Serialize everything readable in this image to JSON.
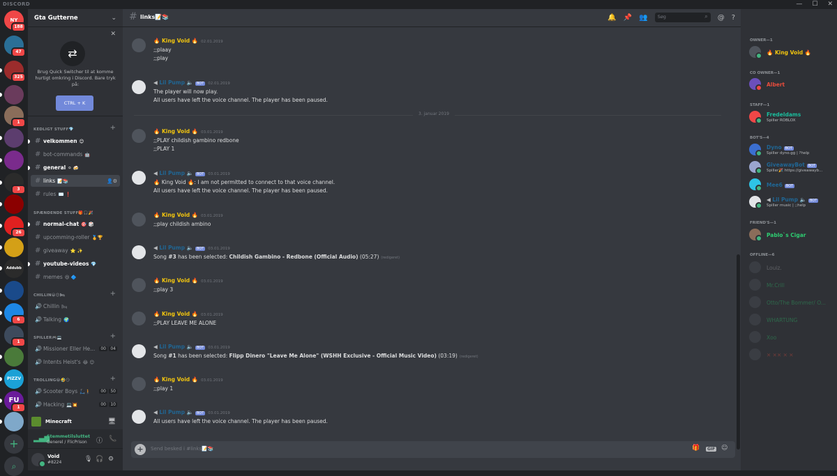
{
  "app": {
    "brand": "DISCORD"
  },
  "window_controls": [
    "—",
    "☐",
    "✕"
  ],
  "guild_rail": {
    "badges": [
      "NY",
      "188",
      "47",
      "325",
      "1",
      "3",
      "26",
      "6",
      "1",
      "1"
    ],
    "text_guilds": [
      "Addubb",
      "PIZZV",
      "FU"
    ]
  },
  "server": {
    "name": "Gta Gutterne"
  },
  "quick_switcher": {
    "message": "Brug Quick Switcher til at komme hurtigt omkring i Discord. Bare tryk på:",
    "button": "CTRL + K"
  },
  "categories": [
    {
      "label": "KEDLIGT STUFF💎"
    },
    {
      "label": "SPÆNDENDE STUFF🎁🎧🎉"
    },
    {
      "label": "CHILLIN😀😊🛏"
    },
    {
      "label": "SPILLER🎮💻"
    },
    {
      "label": "TROLLING😂🤣😏"
    }
  ],
  "channels": {
    "velkommen": {
      "name": "velkommen",
      "extra": "😊"
    },
    "bot_commands": {
      "name": "bot-commands",
      "extra": "🤖"
    },
    "general": {
      "name": "general",
      "extra": "⚪ 🍻"
    },
    "links": {
      "name": "links",
      "extra": "📝📚"
    },
    "rules": {
      "name": "rules",
      "extra": "✉️ ❗"
    },
    "normal_chat": {
      "name": "normal-chat",
      "extra": "🎯 🎲"
    },
    "upcomming_roller": {
      "name": "upcomming-roller",
      "extra": "🏅🏆"
    },
    "giveaway": {
      "name": "giveaway",
      "extra": "⭐ ✨"
    },
    "youtube_videos": {
      "name": "youtube-videos",
      "extra": "💎"
    },
    "memes": {
      "name": "memes",
      "extra": "😆 🔷"
    },
    "chillin": {
      "name": "Chillin",
      "extra": "🛏"
    },
    "talking": {
      "name": "Talking",
      "extra": "🌍"
    },
    "missioner": {
      "name": "Missioner Eller He...",
      "c1": "00",
      "c2": "04"
    },
    "intents": {
      "name": "Intents Heist's",
      "extra": "😂 😊"
    },
    "scooter": {
      "name": "Scooter Boys",
      "extra": "🛴🚶",
      "c1": "00",
      "c2": "50"
    },
    "hacking": {
      "name": "Hacking",
      "extra": "💻💥",
      "c1": "00",
      "c2": "10"
    }
  },
  "minecraft_bar": {
    "name": "Minecraft"
  },
  "voice_status": {
    "title": "Stemmetilsluttet",
    "subtitle": "Generel / FlicPrison"
  },
  "user": {
    "name": "Void",
    "tag": "#8224"
  },
  "chat": {
    "channel": "links📝📚",
    "search_placeholder": "Søg",
    "composer_placeholder": "Send besked i #links📝📚",
    "date_divider": "3. januar 2019",
    "messages": [
      {
        "author": "🔥 King Void 🔥",
        "time": "02.01.2019",
        "lines": [
          ";;plaay",
          ";;play"
        ],
        "color": "#f1c40f"
      },
      {
        "author": "Lil Pump",
        "bot": "BOT",
        "time": "02.01.2019",
        "lines": [
          "The player will now play.",
          "All users have left the voice channel. The player has been paused."
        ],
        "color": "#206694"
      },
      {
        "author": "🔥 King Void 🔥",
        "time": "03.01.2019",
        "lines": [
          ";;PLAY childish gambino redbone",
          ";;PLAY 1"
        ],
        "color": "#f1c40f"
      },
      {
        "author": "Lil Pump",
        "bot": "BOT",
        "time": "03.01.2019",
        "lines": [
          "🔥 King Void 🔥: I am not permitted to connect to that voice channel.",
          "All users have left the voice channel. The player has been paused."
        ],
        "color": "#206694"
      },
      {
        "author": "🔥 King Void 🔥",
        "time": "03.01.2019",
        "lines": [
          ";;play childish ambino"
        ],
        "color": "#f1c40f"
      },
      {
        "author": "Lil Pump",
        "bot": "BOT",
        "time": "03.01.2019",
        "song_prefix": "Song ",
        "song_num": "#3",
        "song_mid": " has been selected: ",
        "song_title": "Childish Gambino - Redbone (Official Audio)",
        "song_dur": " (05:27)",
        "edited": "(redigeret)",
        "color": "#206694"
      },
      {
        "author": "🔥 King Void 🔥",
        "time": "03.01.2019",
        "lines": [
          ";;play 3"
        ],
        "color": "#f1c40f"
      },
      {
        "author": "🔥 King Void 🔥",
        "time": "03.01.2019",
        "lines": [
          ";;PLAY LEAVE ME ALONE"
        ],
        "color": "#f1c40f"
      },
      {
        "author": "Lil Pump",
        "bot": "BOT",
        "time": "03.01.2019",
        "song_prefix": "Song ",
        "song_num": "#1",
        "song_mid": " has been selected: ",
        "song_title": "Flipp Dinero \"Leave Me Alone\" (WSHH Exclusive - Official Music Video)",
        "song_dur": " (03:19)",
        "edited": "(redigeret)",
        "color": "#206694"
      },
      {
        "author": "🔥 King Void 🔥",
        "time": "03.01.2019",
        "lines": [
          ";;play 1"
        ],
        "color": "#f1c40f"
      },
      {
        "author": "Lil Pump",
        "bot": "BOT",
        "time": "03.01.2019",
        "lines": [
          "All users have left the voice channel. The player has been paused."
        ],
        "color": "#206694"
      }
    ]
  },
  "members": {
    "groups": [
      {
        "label": "OWNER—1"
      },
      {
        "label": "CO OWNER—1"
      },
      {
        "label": "STAFF—1"
      },
      {
        "label": "BOT'S—4"
      },
      {
        "label": "FRIEND'S—1"
      },
      {
        "label": "OFFLINE—6"
      }
    ],
    "list": [
      {
        "name": "🔥 King Void 🔥",
        "color": "#f1c40f",
        "status": "#43b581"
      },
      {
        "name": "Albert",
        "color": "#e74c3c",
        "status": "#f04747"
      },
      {
        "name": "Fredeldams",
        "sub": "Spiller ROBLOX",
        "color": "#1abc9c",
        "status": "#43b581"
      },
      {
        "name": "Dyno",
        "bot": "BOT",
        "sub": "Spiller dyno.gg | ?help",
        "color": "#206694",
        "status": "#43b581"
      },
      {
        "name": "GiveawayBot",
        "bot": "BOT",
        "sub": "Spiller🎉 https://giveawayb...",
        "color": "#206694",
        "status": "#43b581"
      },
      {
        "name": "Mee6",
        "bot": "BOT",
        "color": "#206694",
        "status": "#43b581"
      },
      {
        "name": "Lil Pump",
        "bot": "BOT",
        "sub": "Spiller music | ;;help",
        "color": "#206694",
        "status": "#43b581"
      },
      {
        "name": "Pablo`s Cigar",
        "color": "#2ecc71",
        "status": "#43b581"
      },
      {
        "name": "Louiz.",
        "color": "#b9bbbe"
      },
      {
        "name": "Mr.Crill",
        "color": "#2ecc71"
      },
      {
        "name": "Otto/The Bommer/ O...",
        "color": "#2ecc71"
      },
      {
        "name": "WHARTUNG",
        "color": "#2ecc71"
      },
      {
        "name": "Xoo",
        "color": "#2ecc71"
      },
      {
        "name": "✕ ✕✕ ✕ ✕",
        "color": "#e74c3c"
      }
    ]
  }
}
